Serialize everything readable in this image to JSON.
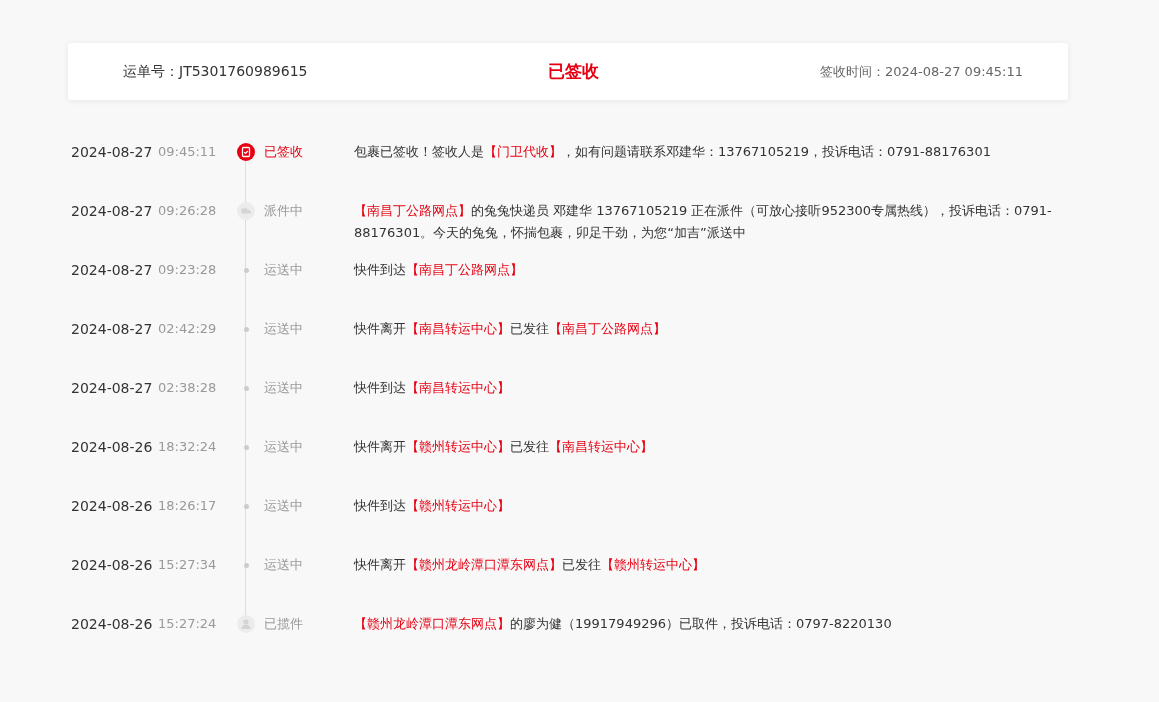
{
  "header": {
    "waybill_label": "运单号：",
    "waybill_number": "JT5301760989615",
    "status": "已签收",
    "signed_time_label": "签收时间：",
    "signed_time": "2024-08-27 09:45:11"
  },
  "events": [
    {
      "date": "2024-08-27",
      "time": "09:45:11",
      "kind": "signed",
      "status": "已签收",
      "description": [
        {
          "text": "包裹已签收！签收人是"
        },
        {
          "text": "【门卫代收】",
          "highlight": true
        },
        {
          "text": "，如有问题请联系邓建华：13767105219，投诉电话：0791-88176301"
        }
      ]
    },
    {
      "date": "2024-08-27",
      "time": "09:26:28",
      "kind": "delivering",
      "status": "派件中",
      "description": [
        {
          "text": "【南昌丁公路网点】",
          "highlight": true
        },
        {
          "text": "的兔兔快递员 邓建华 13767105219 正在派件（可放心接听952300专属热线），投诉电话：0791-88176301。今天的兔兔，怀揣包裹，卯足干劲，为您“加吉”派送中"
        }
      ]
    },
    {
      "date": "2024-08-27",
      "time": "09:23:28",
      "kind": "transit",
      "status": "运送中",
      "description": [
        {
          "text": "快件到达"
        },
        {
          "text": "【南昌丁公路网点】",
          "highlight": true
        }
      ]
    },
    {
      "date": "2024-08-27",
      "time": "02:42:29",
      "kind": "transit",
      "status": "运送中",
      "description": [
        {
          "text": "快件离开"
        },
        {
          "text": "【南昌转运中心】",
          "highlight": true
        },
        {
          "text": "已发往"
        },
        {
          "text": "【南昌丁公路网点】",
          "highlight": true
        }
      ]
    },
    {
      "date": "2024-08-27",
      "time": "02:38:28",
      "kind": "transit",
      "status": "运送中",
      "description": [
        {
          "text": "快件到达"
        },
        {
          "text": "【南昌转运中心】",
          "highlight": true
        }
      ]
    },
    {
      "date": "2024-08-26",
      "time": "18:32:24",
      "kind": "transit",
      "status": "运送中",
      "description": [
        {
          "text": "快件离开"
        },
        {
          "text": "【赣州转运中心】",
          "highlight": true
        },
        {
          "text": "已发往"
        },
        {
          "text": "【南昌转运中心】",
          "highlight": true
        }
      ]
    },
    {
      "date": "2024-08-26",
      "time": "18:26:17",
      "kind": "transit",
      "status": "运送中",
      "description": [
        {
          "text": "快件到达"
        },
        {
          "text": "【赣州转运中心】",
          "highlight": true
        }
      ]
    },
    {
      "date": "2024-08-26",
      "time": "15:27:34",
      "kind": "transit",
      "status": "运送中",
      "description": [
        {
          "text": "快件离开"
        },
        {
          "text": "【赣州龙岭潭口潭东网点】",
          "highlight": true
        },
        {
          "text": "已发往"
        },
        {
          "text": "【赣州转运中心】",
          "highlight": true
        }
      ]
    },
    {
      "date": "2024-08-26",
      "time": "15:27:24",
      "kind": "pickup",
      "status": "已揽件",
      "description": [
        {
          "text": "【赣州龙岭潭口潭东网点】",
          "highlight": true
        },
        {
          "text": "的廖为健（19917949296）已取件，投诉电话：0797-8220130"
        }
      ]
    }
  ]
}
